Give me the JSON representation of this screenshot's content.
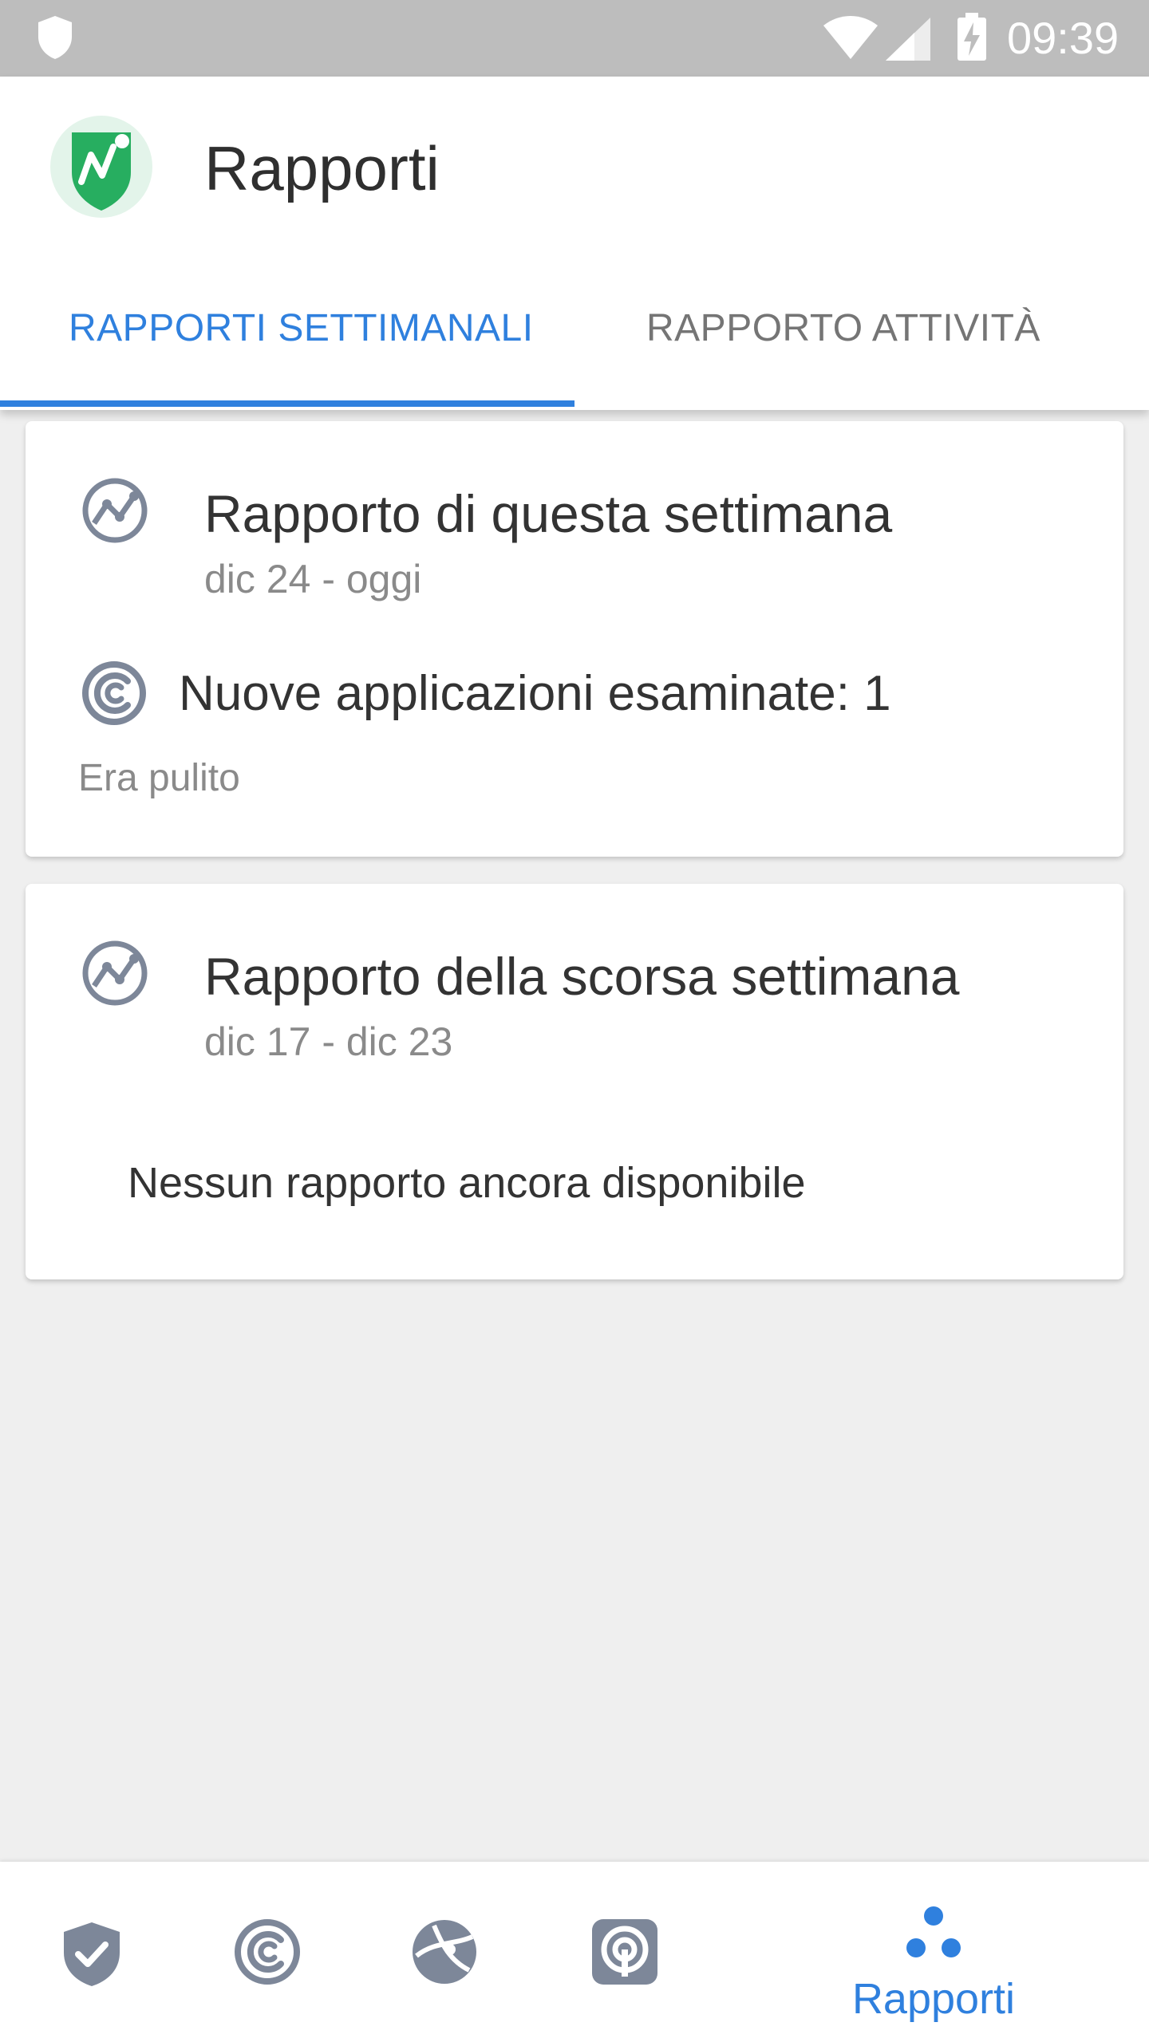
{
  "status_bar": {
    "time": "09:39"
  },
  "header": {
    "title": "Rapporti"
  },
  "tabs": [
    {
      "label": "RAPPORTI SETTIMANALI",
      "selected": true
    },
    {
      "label": "RAPPORTO ATTIVITÀ",
      "selected": false
    }
  ],
  "cards": [
    {
      "title": "Rapporto di questa settimana",
      "date_range": "dic 24 - oggi",
      "scan_summary": "Nuove applicazioni esaminate: 1",
      "status": "Era pulito"
    },
    {
      "title": "Rapporto della scorsa settimana",
      "date_range": "dic 17 - dic 23",
      "empty_message": "Nessun rapporto ancora disponibile"
    }
  ],
  "bottom_nav": {
    "items": [
      {
        "icon": "shield-check-icon"
      },
      {
        "icon": "scan-icon"
      },
      {
        "icon": "browse-icon"
      },
      {
        "icon": "wifi-icon"
      },
      {
        "icon": "reports-dots-icon",
        "label": "Rapporti",
        "selected": true
      }
    ]
  },
  "colors": {
    "accent": "#2f80de",
    "brand_green": "#27ae60",
    "icon_gray": "#7d8799"
  }
}
